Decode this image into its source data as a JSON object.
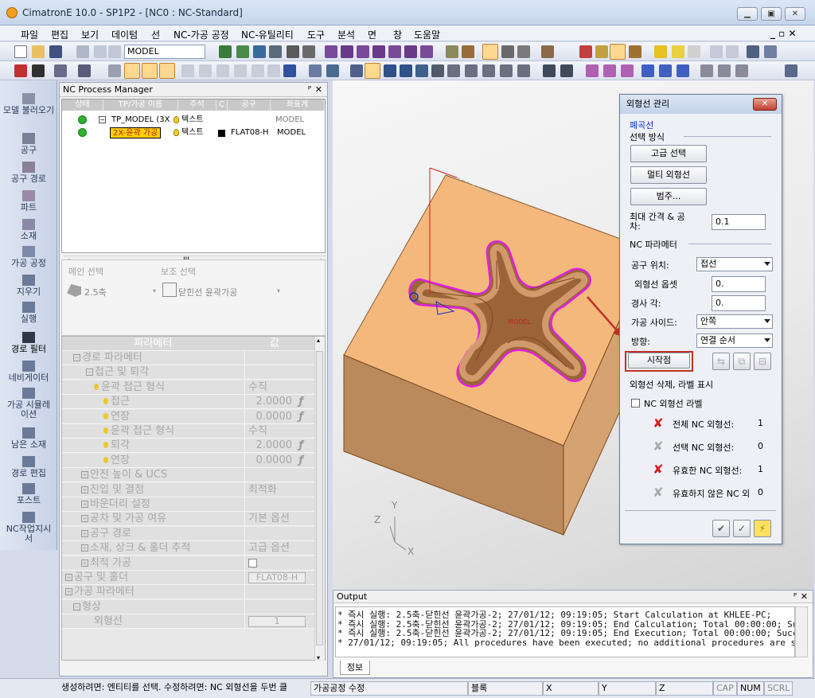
{
  "window": {
    "title": "CimatronE 10.0 - SP1P2 - [NC0 : NC-Standard]",
    "min": "▁",
    "max": "▣",
    "close": "✕"
  },
  "menu": {
    "items": [
      "파일",
      "편집",
      "보기",
      "데이텀",
      "선",
      "NC-가공 공정",
      "NC-유틸리티",
      "도구",
      "분석",
      "면",
      "창",
      "도움말"
    ],
    "right": "_ ▫ ✕"
  },
  "toolbar": {
    "model_combo": "MODEL"
  },
  "palette": {
    "items": [
      "모델 불러오기",
      "공구",
      "공구 경로",
      "파트",
      "소재",
      "가공 공정",
      "지우기",
      "실행",
      "경로 필터",
      "네비게이터",
      "가공 시뮬레이션",
      "남은 소재",
      "경로 편집",
      "포스트",
      "NC작업지시서"
    ]
  },
  "nc_manager": {
    "title": "NC Process Manager",
    "pin": "ᴾ",
    "close": "✕",
    "columns": [
      "상태",
      "TP/가공 이름",
      "주석",
      "C",
      "공구",
      "좌표계"
    ],
    "rows": [
      {
        "name": "TP_MODEL (3X",
        "note": "텍스트",
        "tool": "",
        "ucs": "MODEL"
      },
      {
        "name": "2X-윤곽 가공",
        "note": "텍스트",
        "tool": "FLAT08-H",
        "ucs": "MODEL"
      }
    ],
    "scroll_mark": "III",
    "main_select_label": "메인 선택",
    "sub_select_label": "보조 선택",
    "main_select_value": "2.5축",
    "sub_select_value": "닫힌선 윤곽가공",
    "param_header": {
      "name": "파라메터",
      "value": "값"
    },
    "params": [
      {
        "label": "경로 파라메터",
        "value": "",
        "unit": ""
      },
      {
        "label": "접근 및 퇴각",
        "value": "",
        "unit": ""
      },
      {
        "label": "윤곽 접근 형식",
        "value": "수직",
        "unit": ""
      },
      {
        "label": "접근",
        "value": "2.0000",
        "unit": "ƒ"
      },
      {
        "label": "연장",
        "value": "0.0000",
        "unit": "ƒ"
      },
      {
        "label": "윤곽 접근 형식",
        "value": "수직",
        "unit": ""
      },
      {
        "label": "퇴각",
        "value": "2.0000",
        "unit": "ƒ"
      },
      {
        "label": "연장",
        "value": "0.0000",
        "unit": "ƒ"
      },
      {
        "label": "안전 높이 & UCS",
        "value": "",
        "unit": ""
      },
      {
        "label": "진입 및 결점",
        "value": "최적화",
        "unit": ""
      },
      {
        "label": "바운더리 설정",
        "value": "",
        "unit": ""
      },
      {
        "label": "공차 및 가공 여유",
        "value": "기본 옵션",
        "unit": ""
      },
      {
        "label": "공구 경로",
        "value": "",
        "unit": ""
      },
      {
        "label": "소재, 상크 & 홀더 추적",
        "value": "고급 옵션",
        "unit": ""
      },
      {
        "label": "최적 가공",
        "value": "",
        "unit": ""
      },
      {
        "label": "공구 및 홀더",
        "value": "FLAT08-H",
        "unit": ""
      },
      {
        "label": "가공 파라메터",
        "value": "",
        "unit": ""
      },
      {
        "label": "형상",
        "value": "",
        "unit": ""
      },
      {
        "label": "외형선",
        "value": "1",
        "unit": ""
      }
    ]
  },
  "viewport": {
    "axis_x": "X",
    "axis_y": "Y",
    "axis_z": "Z",
    "model_label": "MODEL"
  },
  "dialog": {
    "title": "외형선 관리",
    "close": "✕",
    "section1": "폐곡선",
    "select_mode": "선택 방식",
    "btn_advanced": "고급 선택",
    "btn_multi": "멀티 외형선",
    "btn_range": "범주...",
    "max_gap_label": "최대 간격 & 공차:",
    "max_gap_value": "0.1",
    "nc_param": "NC 파라메터",
    "tool_pos_label": "공구 위치:",
    "tool_pos_value": "접선",
    "offset_label": "외형선 옵셋",
    "offset_value": "0.",
    "draft_label": "경사 각:",
    "draft_value": "0.",
    "side_label": "가공 사이드:",
    "side_value": "안쪽",
    "dir_label": "방향:",
    "dir_value": "연결 순서",
    "start_btn": "시작점",
    "label_section": "외형선 삭제, 라벨 표시",
    "nc_label_chk": "NC 외형선 라벨",
    "all_label": "전체 NC 외형선:",
    "all_value": "1",
    "sel_label": "선택 NC 외형선:",
    "sel_value": "0",
    "valid_label": "유효한 NC 외형선:",
    "valid_value": "1",
    "invalid_label": "유효하지 않은 NC 외",
    "invalid_value": "0"
  },
  "output": {
    "title": "Output",
    "lines": [
      "* 즉시 실행: 2.5축-닫힌선 윤곽가공-2; 27/01/12; 09:19:05; Start Calculation at KHLEE-PC;",
      "* 즉시 실행: 2.5축-닫힌선 윤곽가공-2; 27/01/12; 09:19:05; End Calculation; Total 00:00:00; Succeeded",
      "* 즉시 실행: 2.5축-닫힌선 윤곽가공-2; 27/01/12; 09:19:05; End Execution; Total 00:00:00; Succeeded",
      "* 27/01/12; 09:19:05; All procedures have been executed; no additional procedures are submitted for exec"
    ],
    "tab": "정보"
  },
  "status": {
    "hint": "생성하려면: 엔티티를 선택. 수정하려면: NC 외형선을 두번 클",
    "mode": "가공공정 수정",
    "block": "블록",
    "x": "X",
    "y": "Y",
    "z": "Z",
    "cap": "CAP",
    "num": "NUM",
    "scrl": "SCRL"
  },
  "colors": {
    "highlight_red": "#c03028",
    "selection_yellow": "#ffd000",
    "contour_magenta": "#e020e0",
    "block_orange": "#f4b87c"
  }
}
